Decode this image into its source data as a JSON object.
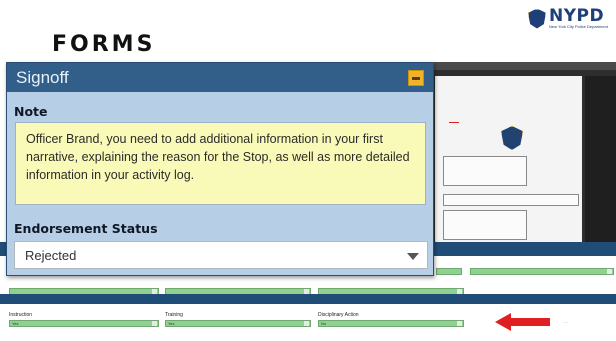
{
  "slide": {
    "title": "FORMS"
  },
  "logo": {
    "word": "NYPD",
    "subtitle": "New York City Police Department"
  },
  "modal": {
    "title": "Signoff",
    "note_label": "Note",
    "note_text": "Officer Brand, you need to add additional information in your first narrative, explaining the reason for the Stop, as well as more detailed information in your activity log.",
    "endorsement_label": "Endorsement Status",
    "endorsement_value": "Rejected"
  },
  "background_form": {
    "labels": [
      "Instruction",
      "Training",
      "Disciplinary Action"
    ],
    "field_values": [
      "Yes",
      "Yes",
      "No"
    ]
  },
  "colors": {
    "modal_header": "#325f8a",
    "modal_body": "#b6cfe6",
    "note_bg": "#fafab8",
    "minimize": "#f2b328",
    "arrow": "#e02020",
    "field_green": "#8fd18f"
  },
  "icons": {
    "minimize": "minimize-icon",
    "dropdown": "chevron-down-icon",
    "arrow": "red-arrow-icon",
    "logo": "nypd-badge-icon"
  }
}
